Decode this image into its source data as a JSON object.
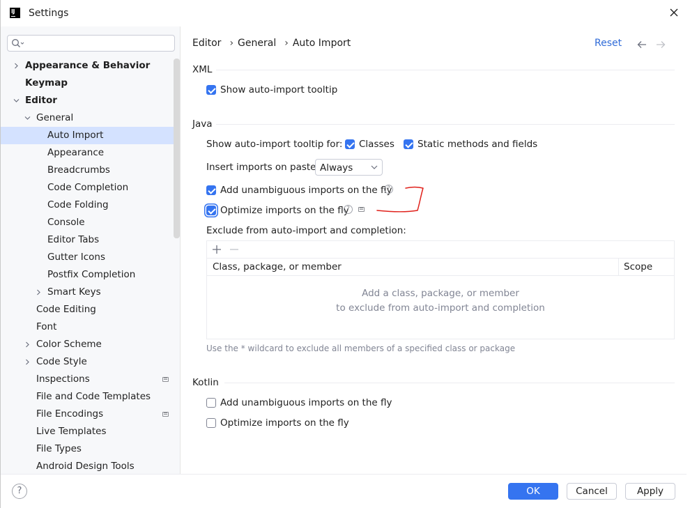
{
  "window": {
    "title": "Settings"
  },
  "search": {
    "placeholder": ""
  },
  "tree": [
    {
      "label": "Appearance & Behavior",
      "depth": 0,
      "bold": true,
      "chevron": "right"
    },
    {
      "label": "Keymap",
      "depth": 0,
      "bold": true,
      "chevron": ""
    },
    {
      "label": "Editor",
      "depth": 0,
      "bold": true,
      "chevron": "down"
    },
    {
      "label": "General",
      "depth": 1,
      "bold": false,
      "chevron": "down"
    },
    {
      "label": "Auto Import",
      "depth": 2,
      "bold": false,
      "chevron": "",
      "selected": true
    },
    {
      "label": "Appearance",
      "depth": 2,
      "bold": false,
      "chevron": ""
    },
    {
      "label": "Breadcrumbs",
      "depth": 2,
      "bold": false,
      "chevron": ""
    },
    {
      "label": "Code Completion",
      "depth": 2,
      "bold": false,
      "chevron": ""
    },
    {
      "label": "Code Folding",
      "depth": 2,
      "bold": false,
      "chevron": ""
    },
    {
      "label": "Console",
      "depth": 2,
      "bold": false,
      "chevron": ""
    },
    {
      "label": "Editor Tabs",
      "depth": 2,
      "bold": false,
      "chevron": ""
    },
    {
      "label": "Gutter Icons",
      "depth": 2,
      "bold": false,
      "chevron": ""
    },
    {
      "label": "Postfix Completion",
      "depth": 2,
      "bold": false,
      "chevron": ""
    },
    {
      "label": "Smart Keys",
      "depth": 2,
      "bold": false,
      "chevron": "right"
    },
    {
      "label": "Code Editing",
      "depth": 1,
      "bold": false,
      "chevron": ""
    },
    {
      "label": "Font",
      "depth": 1,
      "bold": false,
      "chevron": ""
    },
    {
      "label": "Color Scheme",
      "depth": 1,
      "bold": false,
      "chevron": "right"
    },
    {
      "label": "Code Style",
      "depth": 1,
      "bold": false,
      "chevron": "right"
    },
    {
      "label": "Inspections",
      "depth": 1,
      "bold": false,
      "chevron": "",
      "modified": true
    },
    {
      "label": "File and Code Templates",
      "depth": 1,
      "bold": false,
      "chevron": ""
    },
    {
      "label": "File Encodings",
      "depth": 1,
      "bold": false,
      "chevron": "",
      "modified": true
    },
    {
      "label": "Live Templates",
      "depth": 1,
      "bold": false,
      "chevron": ""
    },
    {
      "label": "File Types",
      "depth": 1,
      "bold": false,
      "chevron": ""
    },
    {
      "label": "Android Design Tools",
      "depth": 1,
      "bold": false,
      "chevron": ""
    }
  ],
  "breadcrumb": [
    "Editor",
    "General",
    "Auto Import"
  ],
  "header": {
    "reset": "Reset",
    "back_icon": "arrow-left-icon",
    "forward_icon": "arrow-right-icon"
  },
  "xml": {
    "title": "XML",
    "show_tooltip": {
      "label": "Show auto-import tooltip",
      "checked": true
    }
  },
  "java": {
    "title": "Java",
    "tooltip_for_label": "Show auto-import tooltip for:",
    "classes": {
      "label": "Classes",
      "checked": true
    },
    "static_methods": {
      "label": "Static methods and fields",
      "checked": true
    },
    "insert_imports_label": "Insert imports on paste:",
    "insert_imports_value": "Always",
    "add_unambiguous": {
      "label": "Add unambiguous imports on the fly",
      "checked": true
    },
    "optimize_imports": {
      "label": "Optimize imports on the fly",
      "checked": true
    },
    "exclude_label": "Exclude from auto-import and completion:",
    "table_col_1": "Class, package, or member",
    "table_col_2": "Scope",
    "empty_line_1": "Add a class, package, or member",
    "empty_line_2": "to exclude from auto-import and completion",
    "hint": "Use the * wildcard to exclude all members of a specified class or package"
  },
  "kotlin": {
    "title": "Kotlin",
    "add_unambiguous": {
      "label": "Add unambiguous imports on the fly",
      "checked": false
    },
    "optimize_imports": {
      "label": "Optimize imports on the fly",
      "checked": false
    }
  },
  "footer": {
    "ok": "OK",
    "cancel": "Cancel",
    "apply": "Apply"
  },
  "colors": {
    "accent": "#3574f0",
    "selection": "#d4e2ff",
    "annotation": "#e0201a"
  }
}
